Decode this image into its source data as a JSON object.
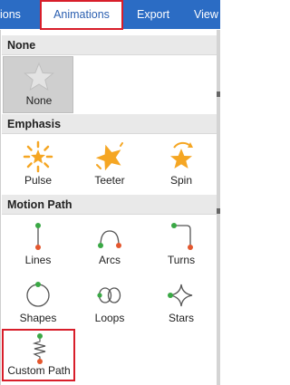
{
  "ribbon": {
    "tabs": [
      {
        "label": "ions"
      },
      {
        "label": "Animations"
      },
      {
        "label": "Export"
      },
      {
        "label": "View"
      }
    ]
  },
  "sections": [
    {
      "title": "None",
      "items": [
        {
          "label": "None",
          "icon": "gray-star-icon"
        }
      ]
    },
    {
      "title": "Emphasis",
      "items": [
        {
          "label": "Pulse",
          "icon": "pulse-burst-icon"
        },
        {
          "label": "Teeter",
          "icon": "teeter-star-icon"
        },
        {
          "label": "Spin",
          "icon": "spin-star-icon"
        }
      ]
    },
    {
      "title": "Motion Path",
      "items": [
        {
          "label": "Lines",
          "icon": "line-path-icon"
        },
        {
          "label": "Arcs",
          "icon": "arc-path-icon"
        },
        {
          "label": "Turns",
          "icon": "turn-path-icon"
        },
        {
          "label": "Shapes",
          "icon": "circle-path-icon"
        },
        {
          "label": "Loops",
          "icon": "loop-path-icon"
        },
        {
          "label": "Stars",
          "icon": "star-path-icon"
        },
        {
          "label": "Custom Path",
          "icon": "custom-zigzag-path-icon"
        }
      ]
    }
  ],
  "colors": {
    "ribbon": "#2b6cc4",
    "highlight_border": "#d81e2a",
    "star_orange": "#f5a623",
    "path_start": "#3aa845",
    "path_end": "#e4572e"
  }
}
